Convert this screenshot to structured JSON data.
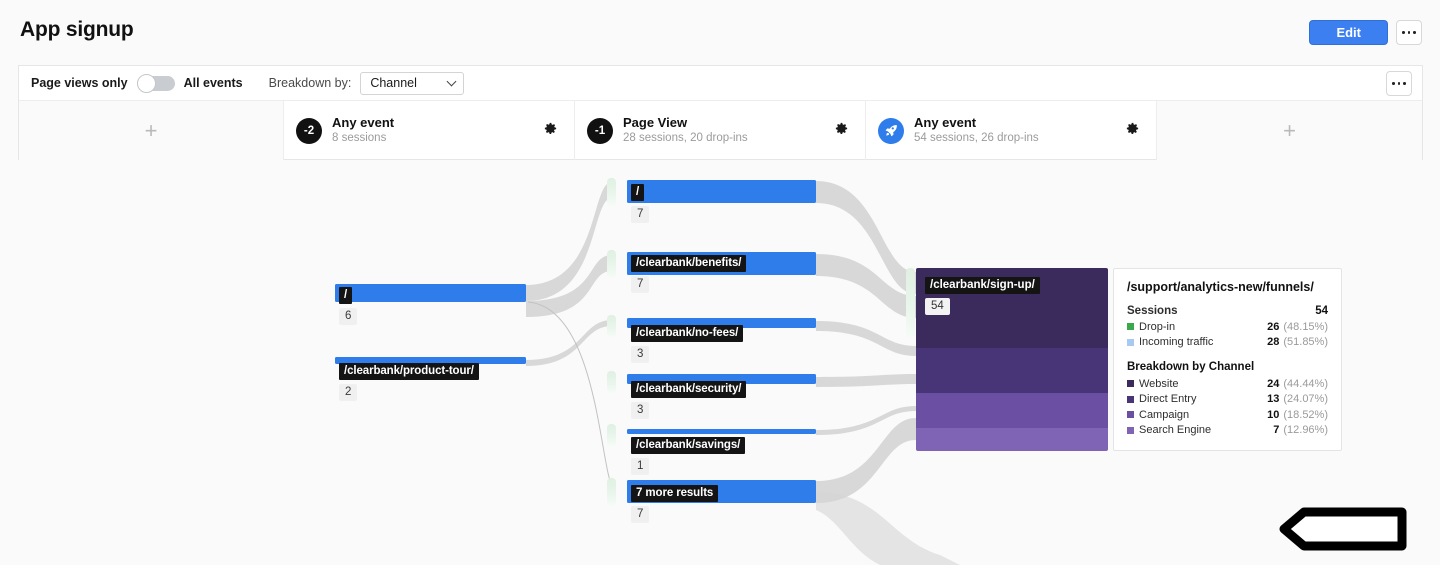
{
  "header": {
    "title": "App signup",
    "edit_label": "Edit",
    "more_icon": "ellipsis-icon"
  },
  "toolbar": {
    "left_label": "Page views only",
    "right_label": "All events",
    "toggle_state": "off",
    "breakdown_label": "Breakdown by:",
    "breakdown_value": "Channel",
    "breakdown_options": [
      "Channel"
    ],
    "more_icon": "ellipsis-icon"
  },
  "steps": [
    {
      "type": "add",
      "plus": "+"
    },
    {
      "type": "event",
      "badge": "-2",
      "badge_style": "dark",
      "name": "Any event",
      "sub": "8 sessions"
    },
    {
      "type": "event",
      "badge": "-1",
      "badge_style": "dark",
      "name": "Page View",
      "sub": "28 sessions, 20 drop-ins"
    },
    {
      "type": "event",
      "badge": "",
      "badge_style": "rocket",
      "name": "Any event",
      "sub": "54 sessions, 26 drop-ins"
    },
    {
      "type": "add",
      "plus": "+"
    }
  ],
  "sankey": {
    "left_nodes": [
      {
        "label": "/",
        "count": "6",
        "value": 6
      },
      {
        "label": "/clearbank/product-tour/",
        "count": "2",
        "value": 2
      }
    ],
    "mid_nodes": [
      {
        "label": "/",
        "count": "7",
        "value": 7
      },
      {
        "label": "/clearbank/benefits/",
        "count": "7",
        "value": 7
      },
      {
        "label": "/clearbank/no-fees/",
        "count": "3",
        "value": 3
      },
      {
        "label": "/clearbank/security/",
        "count": "3",
        "value": 3
      },
      {
        "label": "/clearbank/savings/",
        "count": "1",
        "value": 1
      },
      {
        "label": "7 more results",
        "count": "7",
        "value": 7
      }
    ],
    "destination": {
      "label": "/clearbank/sign-up/",
      "count": "54",
      "segments": [
        {
          "name": "Website",
          "color": "#3b2a5c"
        },
        {
          "name": "Direct Entry",
          "color": "#483578"
        },
        {
          "name": "Campaign",
          "color": "#6a4fa3"
        },
        {
          "name": "Search Engine",
          "color": "#7f63b4"
        }
      ]
    },
    "node_color": "#2f7ceb",
    "link_color": "#d6d6d6"
  },
  "detail": {
    "title": "/support/analytics-new/funnels/",
    "sessions_label": "Sessions",
    "sessions_value": "54",
    "summary": [
      {
        "name": "Drop-in",
        "value": "26",
        "pct": "(48.15%)",
        "color": "#3aa94c"
      },
      {
        "name": "Incoming traffic",
        "value": "28",
        "pct": "(51.85%)",
        "color": "#a9c9f5"
      }
    ],
    "breakdown_title": "Breakdown by Channel",
    "breakdown": [
      {
        "name": "Website",
        "value": "24",
        "pct": "(44.44%)",
        "color": "#3b2a5c"
      },
      {
        "name": "Direct Entry",
        "value": "13",
        "pct": "(24.07%)",
        "color": "#483578"
      },
      {
        "name": "Campaign",
        "value": "10",
        "pct": "(18.52%)",
        "color": "#6a4fa3"
      },
      {
        "name": "Search Engine",
        "value": "7",
        "pct": "(12.96%)",
        "color": "#7f63b4"
      }
    ]
  },
  "annotation": {
    "shape": "left-arrow-outline",
    "color": "#000000"
  }
}
